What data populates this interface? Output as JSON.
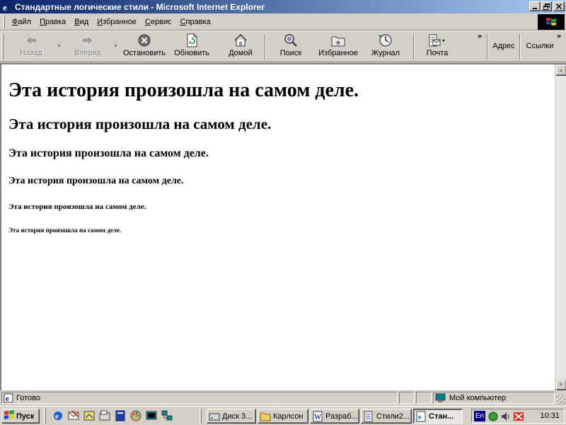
{
  "window": {
    "title": "Стандартные логические стили - Microsoft Internet Explorer"
  },
  "menu": {
    "items": [
      {
        "ul": "Ф",
        "rest": "айл"
      },
      {
        "ul": "П",
        "rest": "равка"
      },
      {
        "ul": "В",
        "rest": "ид"
      },
      {
        "ul": "И",
        "rest": "збранное"
      },
      {
        "ul": "С",
        "rest": "ервис"
      },
      {
        "ul": "С",
        "rest": "правка"
      }
    ]
  },
  "toolbar": {
    "back": "Назад",
    "forward": "Вперед",
    "stop": "Остановить",
    "refresh": "Обновить",
    "home": "Домой",
    "search": "Поиск",
    "favorites": "Избранное",
    "history": "Журнал",
    "mail": "Почта",
    "address": "Адрес",
    "links": "Ссылки",
    "chevron": "»"
  },
  "content": {
    "h1": "Эта история произошла на самом деле.",
    "h2": "Эта история произошла на самом деле.",
    "h3": "Эта история произошла на самом деле.",
    "h4": "Эта история произошла на самом деле.",
    "h5": "Эта история произошла на самом деле.",
    "h6": "Эта история произошла на самом деле."
  },
  "status": {
    "text": "Готово",
    "zone": "Мой компьютер"
  },
  "taskbar": {
    "start": "Пуск",
    "tasks": [
      "Диск 3...",
      "Карлсон",
      "Разраб...",
      "Стили2...",
      "Стан..."
    ],
    "clock": "10:31",
    "lang": "En"
  },
  "colors": {
    "titlebar_start": "#0a246a",
    "titlebar_end": "#a6caf0",
    "chrome": "#d4d0c8",
    "content_bg": "#ffffff"
  },
  "icons": {
    "back": "arrow-left-icon",
    "forward": "arrow-right-icon",
    "stop": "stop-icon",
    "refresh": "refresh-icon",
    "home": "house-icon",
    "search": "magnifier-icon",
    "favorites": "folder-star-icon",
    "history": "history-icon",
    "mail": "mail-icon"
  }
}
